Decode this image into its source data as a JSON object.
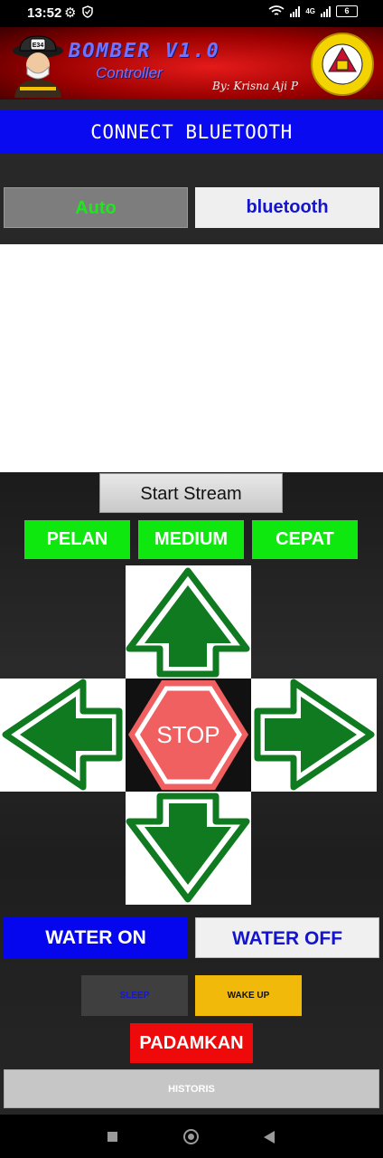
{
  "status_bar": {
    "time": "13:52",
    "network_label": "4G",
    "battery_level": "6"
  },
  "banner": {
    "title": "BOMBER V1.0",
    "subtitle": "Controller",
    "author": "By: Krisna Aji P",
    "helmet_badge": "E34"
  },
  "connect": {
    "label": "CONNECT BLUETOOTH"
  },
  "mode": {
    "auto_label": "Auto",
    "bluetooth_label": "bluetooth"
  },
  "stream": {
    "label": "Start Stream"
  },
  "speed": {
    "slow": "PELAN",
    "medium": "MEDIUM",
    "fast": "CEPAT"
  },
  "dpad": {
    "stop_label": "STOP"
  },
  "water": {
    "on_label": "WATER ON",
    "off_label": "WATER OFF"
  },
  "power": {
    "sleep_label": "SLEEP",
    "wake_label": "WAKE UP"
  },
  "extinguish": {
    "label": "PADAMKAN"
  },
  "history": {
    "label": "HISTORIS"
  },
  "colors": {
    "arrow_green": "#0f7a1f",
    "stop_red": "#f06060",
    "speed_green": "#0ee80e",
    "bluetooth_blue": "#0a0af0",
    "banner_red": "#d01010"
  },
  "icons": [
    "settings-icon",
    "shield-icon",
    "wifi-icon",
    "signal-icon",
    "battery-icon",
    "firefighter-logo",
    "university-seal",
    "arrow-up-icon",
    "arrow-left-icon",
    "arrow-right-icon",
    "arrow-down-icon",
    "stop-sign-icon"
  ]
}
